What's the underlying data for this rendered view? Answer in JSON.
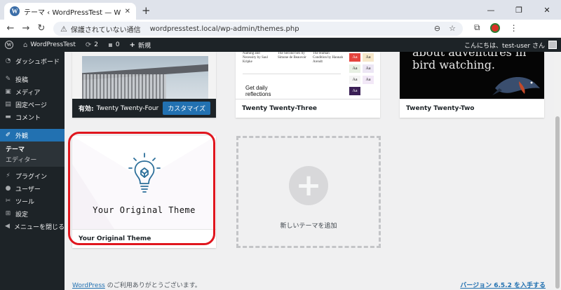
{
  "browser": {
    "tab_title": "テーマ ‹ WordPressTest — WordPress",
    "tab_favicon": "W",
    "new_tab": "+",
    "security_label": "保護されていない通信",
    "url": "wordpresstest.local/wp-admin/themes.php",
    "icons": [
      "back-icon",
      "forward-icon",
      "reload-icon",
      "zoom-icon",
      "bookmark-star-icon",
      "extensions-icon",
      "profile-icon",
      "more-icon"
    ]
  },
  "adminbar": {
    "site_name": "WordPressTest",
    "updates_count": "2",
    "comments_count": "0",
    "new_label": "新規",
    "greeting": "こんにちは、test-user さん"
  },
  "sidebar": {
    "items": [
      {
        "icon": "dashboard-icon",
        "label": "ダッシュボード"
      },
      {
        "icon": "pin-icon",
        "label": "投稿"
      },
      {
        "icon": "media-icon",
        "label": "メディア"
      },
      {
        "icon": "page-icon",
        "label": "固定ページ"
      },
      {
        "icon": "comment-icon",
        "label": "コメント"
      },
      {
        "icon": "appearance-icon",
        "label": "外観"
      },
      {
        "icon": "plugin-icon",
        "label": "プラグイン"
      },
      {
        "icon": "users-icon",
        "label": "ユーザー"
      },
      {
        "icon": "tools-icon",
        "label": "ツール"
      },
      {
        "icon": "settings-icon",
        "label": "設定"
      },
      {
        "icon": "collapse-icon",
        "label": "メニューを閉じる"
      }
    ],
    "submenu": [
      {
        "label": "テーマ"
      },
      {
        "label": "エディター"
      }
    ]
  },
  "themes": {
    "tt4": {
      "active_prefix": "有効:",
      "name": "Twenty Twenty-Four",
      "customize_label": "カスタマイズ"
    },
    "tt3": {
      "name": "Twenty Twenty-Three",
      "col1": "Naming and Necessity by Saul Kripke",
      "col2": "The Second Sex by Simone de Beauvoir",
      "col3": "The Human Condition by Hannah Arendt",
      "get_daily": "Get daily reflections",
      "swatch_label": "Aa"
    },
    "tt2": {
      "name": "Twenty Twenty-Two",
      "preview_text": "about adventures in bird watching."
    },
    "custom": {
      "name": "Your Original Theme",
      "preview_title": "Your Original Theme"
    },
    "add_new_label": "新しいテーマを追加"
  },
  "footer": {
    "wordpress_link": "WordPress",
    "thanks_text": " のご利用ありがとうございます。",
    "version_link": "バージョン 6.5.2 を入手する"
  },
  "colors": {
    "admin_dark": "#1d2327",
    "accent_blue": "#2271b1",
    "highlight_red": "#e0161e"
  }
}
